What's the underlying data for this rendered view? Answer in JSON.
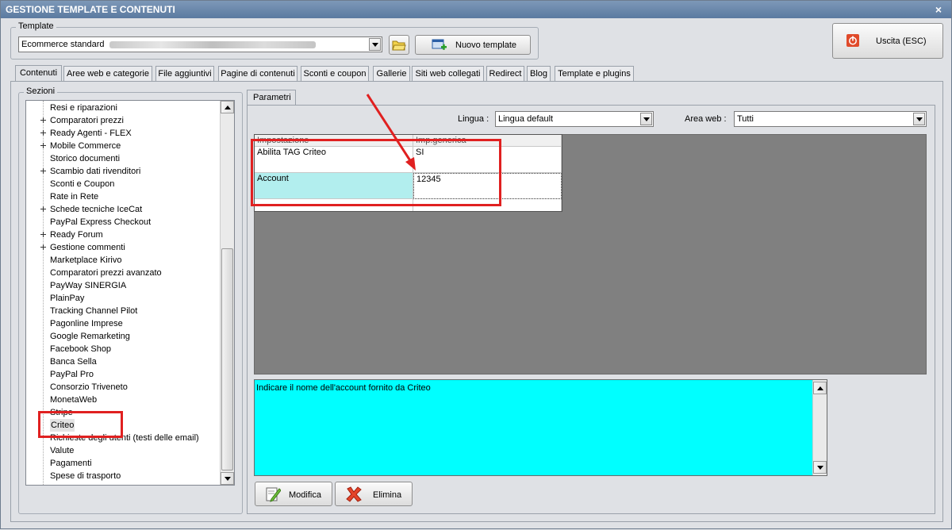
{
  "window": {
    "title": "GESTIONE TEMPLATE E CONTENUTI",
    "close_glyph": "×"
  },
  "template_group": {
    "legend": "Template",
    "selected": "Ecommerce standard",
    "new_button": "Nuovo template"
  },
  "exit_button": "Uscita (ESC)",
  "tabs": [
    "Contenuti",
    "Aree web e categorie",
    "File aggiuntivi",
    "Pagine di contenuti",
    "Sconti e coupon",
    "Gallerie",
    "Siti web collegati",
    "Redirect",
    "Blog",
    "Template e plugins"
  ],
  "active_tab": "Contenuti",
  "sections": {
    "legend": "Sezioni",
    "items": [
      {
        "label": "Resi e riparazioni",
        "expandable": false
      },
      {
        "label": "Comparatori prezzi",
        "expandable": true
      },
      {
        "label": "Ready Agenti - FLEX",
        "expandable": true
      },
      {
        "label": "Mobile Commerce",
        "expandable": true
      },
      {
        "label": "Storico documenti",
        "expandable": false
      },
      {
        "label": "Scambio dati rivenditori",
        "expandable": true
      },
      {
        "label": "Sconti e Coupon",
        "expandable": false
      },
      {
        "label": "Rate in Rete",
        "expandable": false
      },
      {
        "label": "Schede tecniche IceCat",
        "expandable": true
      },
      {
        "label": "PayPal Express Checkout",
        "expandable": false
      },
      {
        "label": "Ready Forum",
        "expandable": true
      },
      {
        "label": "Gestione commenti",
        "expandable": true
      },
      {
        "label": "Marketplace Kirivo",
        "expandable": false
      },
      {
        "label": "Comparatori prezzi avanzato",
        "expandable": false
      },
      {
        "label": "PayWay SINERGIA",
        "expandable": false
      },
      {
        "label": "PlainPay",
        "expandable": false
      },
      {
        "label": "Tracking Channel Pilot",
        "expandable": false
      },
      {
        "label": "Pagonline Imprese",
        "expandable": false
      },
      {
        "label": "Google Remarketing",
        "expandable": false
      },
      {
        "label": "Facebook Shop",
        "expandable": false
      },
      {
        "label": "Banca Sella",
        "expandable": false
      },
      {
        "label": "PayPal Pro",
        "expandable": false
      },
      {
        "label": "Consorzio Triveneto",
        "expandable": false
      },
      {
        "label": "MonetaWeb",
        "expandable": false
      },
      {
        "label": "Stripe",
        "expandable": false
      },
      {
        "label": "Criteo",
        "expandable": false,
        "selected": true
      },
      {
        "label": "Richieste degli utenti (testi delle email)",
        "expandable": false
      },
      {
        "label": "Valute",
        "expandable": false
      },
      {
        "label": "Pagamenti",
        "expandable": false
      },
      {
        "label": "Spese di trasporto",
        "expandable": false
      }
    ]
  },
  "params": {
    "tab": "Parametri",
    "lingua_label": "Lingua :",
    "lingua_value": "Lingua default",
    "area_label": "Area web :",
    "area_value": "Tutti",
    "grid": {
      "headers": [
        "Impostazione",
        "Imp.generica"
      ],
      "rows": [
        {
          "name": "Abilita TAG Criteo",
          "value": "SI"
        },
        {
          "name": "Account",
          "value": "12345"
        }
      ]
    },
    "description": "Indicare il nome dell'account fornito da Criteo",
    "modify_button": "Modifica",
    "delete_button": "Elimina"
  },
  "colors": {
    "annotation_red": "#e02020",
    "selected_row": "#b2eeee",
    "description_bg": "#00ffff"
  }
}
